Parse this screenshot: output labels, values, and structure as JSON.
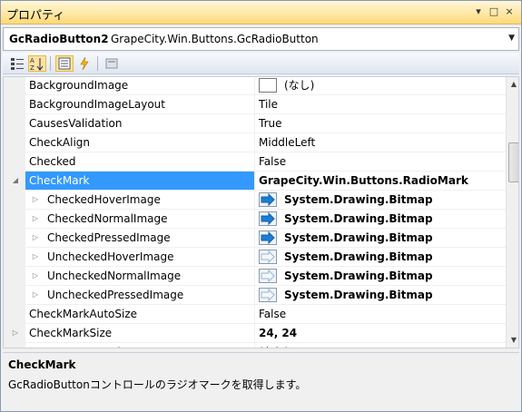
{
  "titlebar": {
    "title": "プロパティ",
    "pin_glyph": "▾",
    "maximize_glyph": "□",
    "close_glyph": "×"
  },
  "object_selector": {
    "name": "GcRadioButton2",
    "type": "GrapeCity.Win.Buttons.GcRadioButton",
    "dropdown_glyph": "▼"
  },
  "toolbar": {
    "buttons": [
      "categorized-icon",
      "alphabetical-icon",
      "properties-icon",
      "events-icon",
      "property-pages-icon"
    ]
  },
  "grid": {
    "rows": [
      {
        "name": "BackgroundImage",
        "value": "(なし)",
        "kind": "swatch"
      },
      {
        "name": "BackgroundImageLayout",
        "value": "Tile"
      },
      {
        "name": "CausesValidation",
        "value": "True"
      },
      {
        "name": "CheckAlign",
        "value": "MiddleLeft"
      },
      {
        "name": "Checked",
        "value": "False"
      },
      {
        "name": "CheckMark",
        "value": "GrapeCity.Win.Buttons.RadioMark",
        "selected": true,
        "bold": true,
        "expander": "◢"
      },
      {
        "name": "CheckedHoverImage",
        "value": "System.Drawing.Bitmap",
        "child": true,
        "bold": true,
        "bitmap": "filled",
        "expander": "▷"
      },
      {
        "name": "CheckedNormalImage",
        "value": "System.Drawing.Bitmap",
        "child": true,
        "bold": true,
        "bitmap": "filled",
        "expander": "▷"
      },
      {
        "name": "CheckedPressedImage",
        "value": "System.Drawing.Bitmap",
        "child": true,
        "bold": true,
        "bitmap": "filled",
        "expander": "▷"
      },
      {
        "name": "UncheckedHoverImage",
        "value": "System.Drawing.Bitmap",
        "child": true,
        "bold": true,
        "bitmap": "empty",
        "expander": "▷"
      },
      {
        "name": "UncheckedNormalImage",
        "value": "System.Drawing.Bitmap",
        "child": true,
        "bold": true,
        "bitmap": "empty",
        "expander": "▷"
      },
      {
        "name": "UncheckedPressedImage",
        "value": "System.Drawing.Bitmap",
        "child": true,
        "bold": true,
        "bitmap": "empty",
        "expander": "▷"
      },
      {
        "name": "CheckMarkAutoSize",
        "value": "False"
      },
      {
        "name": "CheckMarkSize",
        "value": "24, 24",
        "bold": true,
        "expander": "▷"
      },
      {
        "name": "ContextMenuStrip",
        "value": "(なし)"
      }
    ]
  },
  "scrollbar": {
    "up_glyph": "▲",
    "down_glyph": "▼"
  },
  "description": {
    "title": "CheckMark",
    "text": "GcRadioButtonコントロールのラジオマークを取得します。"
  },
  "colors": {
    "selection": "#3399ff",
    "arrow": "#1a7fd4"
  }
}
